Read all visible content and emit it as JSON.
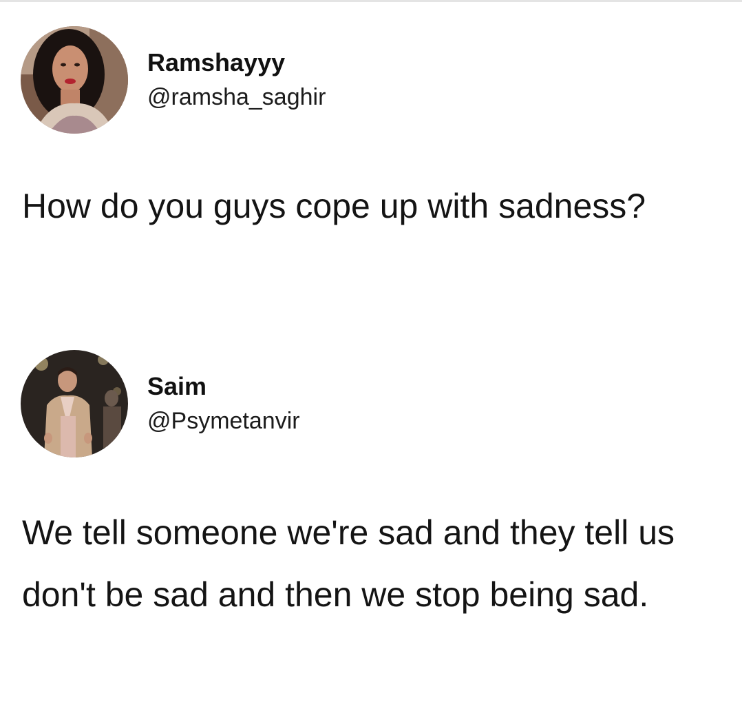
{
  "tweets": [
    {
      "display_name": "Ramshayyy",
      "handle": "@ramsha_saghir",
      "text": "How do you guys cope up with sadness?",
      "avatar_icon": "profile-photo-woman"
    },
    {
      "display_name": "Saim",
      "handle": "@Psymetanvir",
      "text": "We tell someone we're sad and they tell us don't be sad and then we stop being sad.",
      "avatar_icon": "profile-photo-man"
    }
  ],
  "colors": {
    "background": "#ffffff",
    "text": "#141414",
    "divider": "#e4e4e4"
  }
}
